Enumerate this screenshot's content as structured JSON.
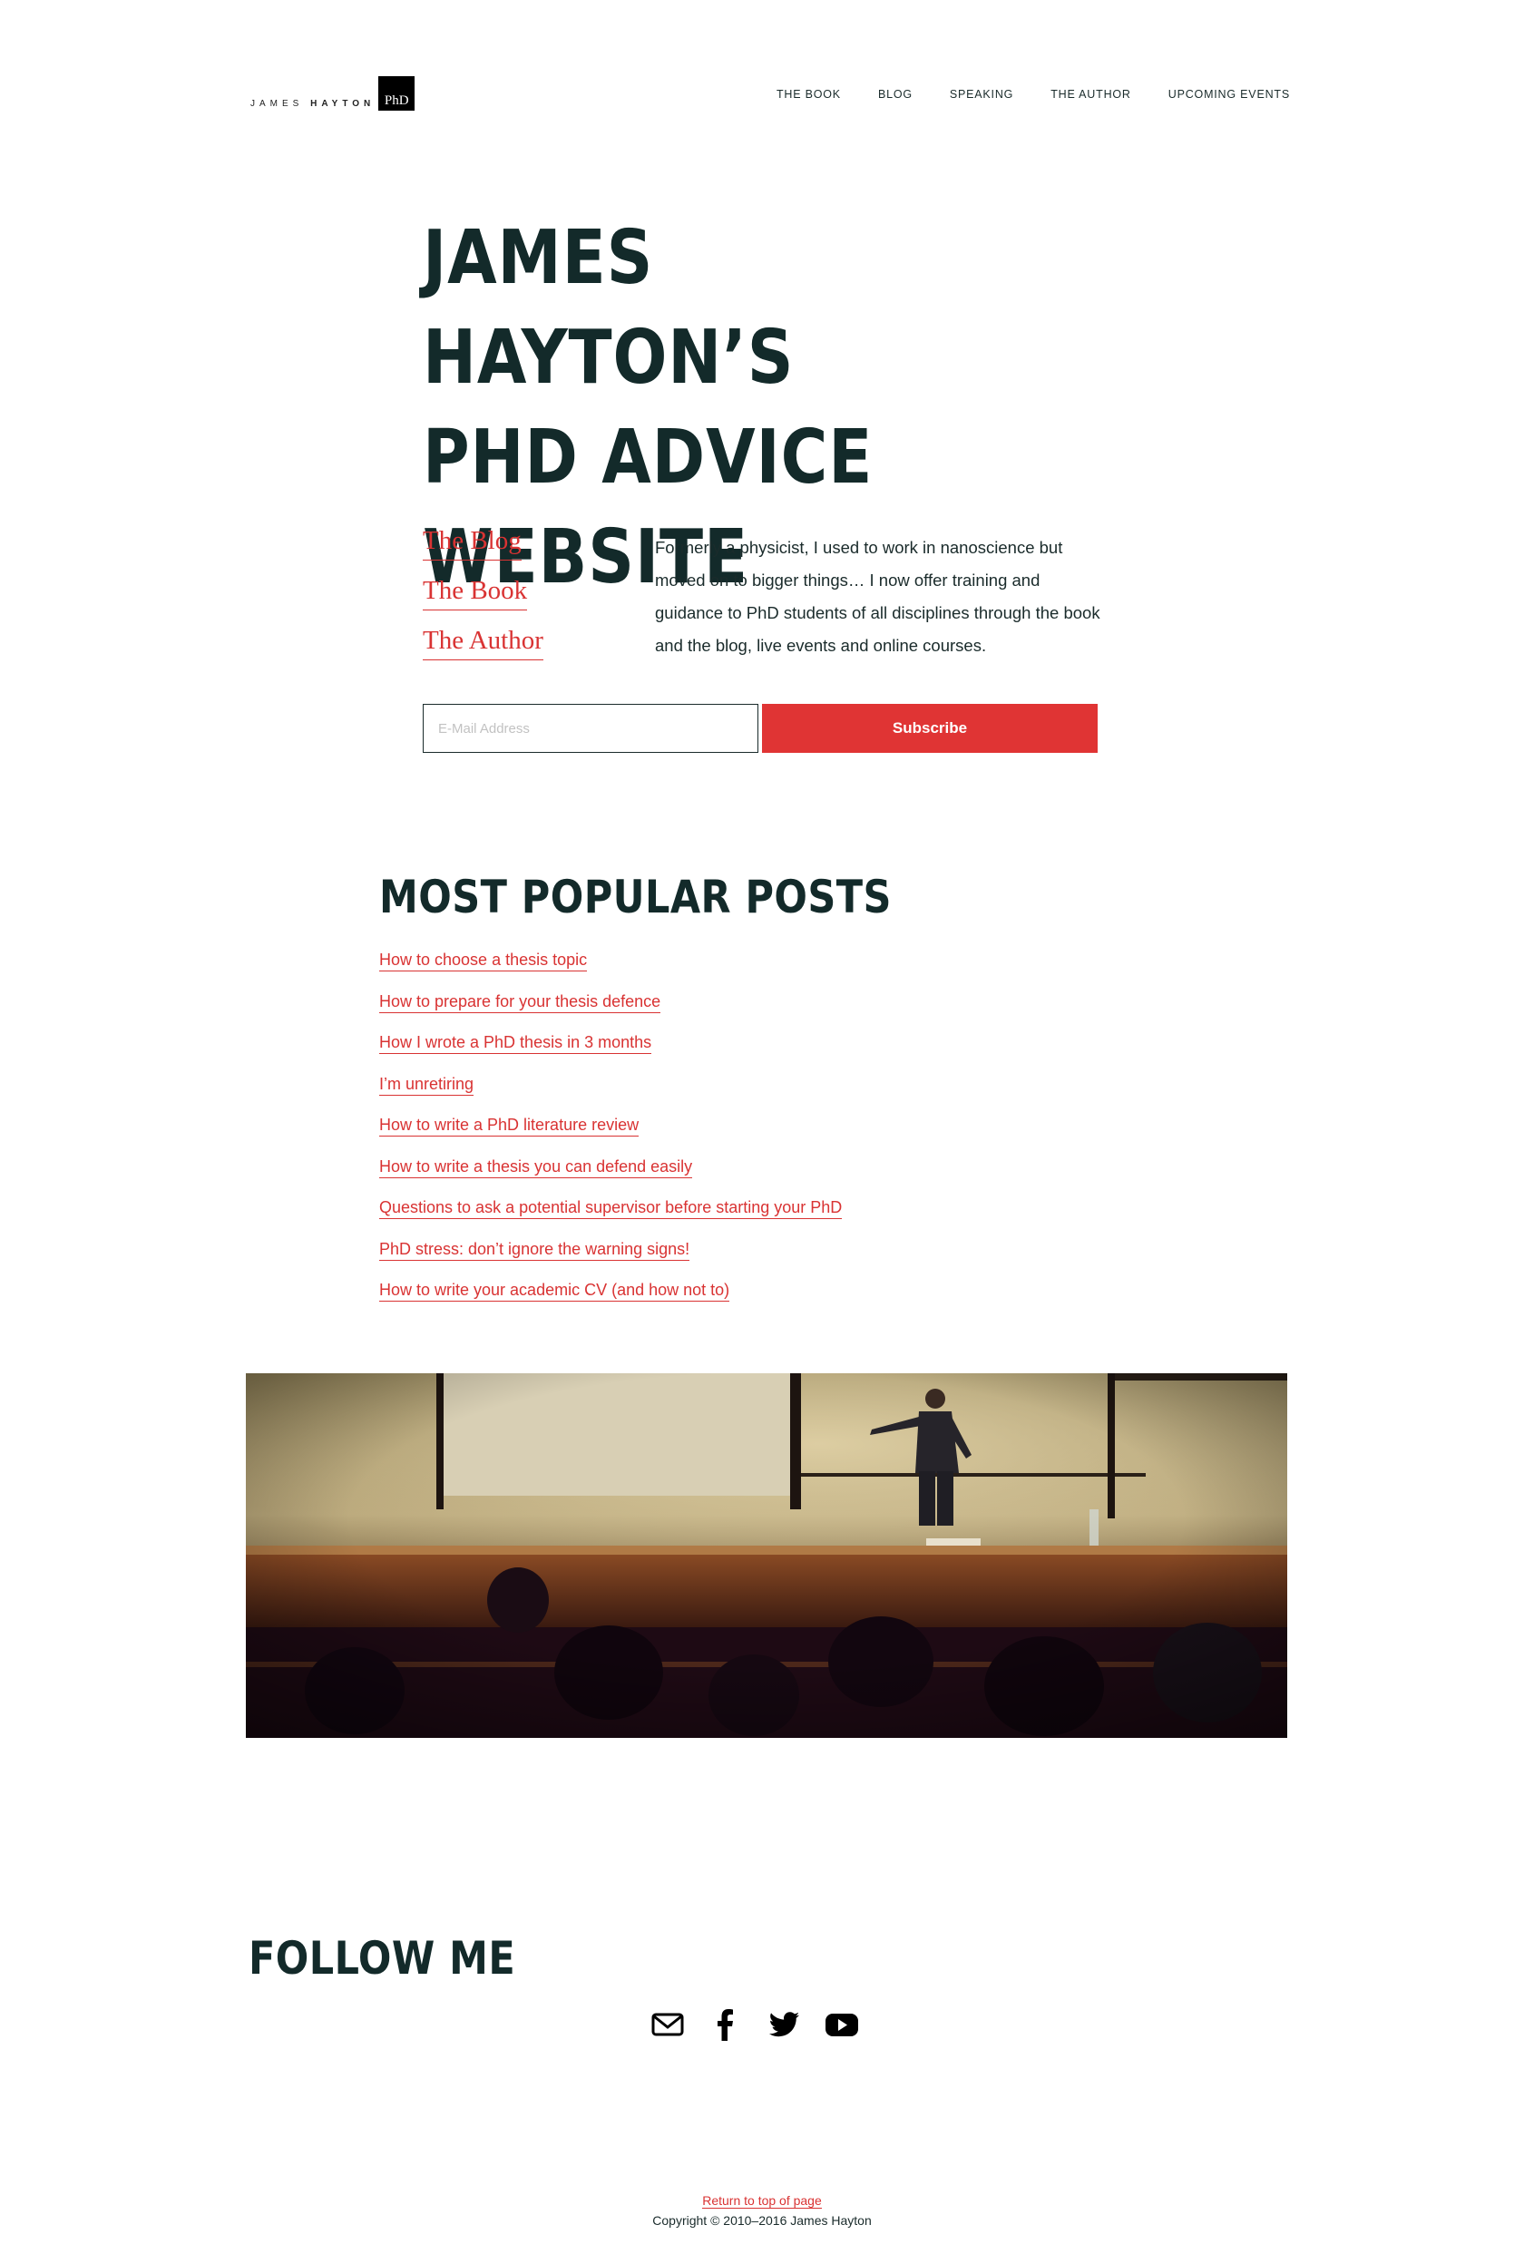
{
  "header": {
    "logo": {
      "first": "JAMES",
      "last": "HAYTON",
      "badge": "PhD"
    },
    "nav": [
      "The Book",
      "Blog",
      "Speaking",
      "The Author",
      "Upcoming Events"
    ]
  },
  "hero": {
    "title_lines": [
      "James Hayton’s",
      "PhD Advice",
      "Website"
    ],
    "links": [
      "The Blog",
      "The Book",
      "The Author"
    ],
    "intro": "Formerly a physicist, I used to work in nanoscience but moved on to bigger things… I now offer training and guidance to PhD students of all disciplines through the book and the blog, live events and online courses.",
    "email_placeholder": "E-Mail Address",
    "subscribe_label": "Subscribe"
  },
  "popular": {
    "title": "Most Popular Posts",
    "posts": [
      "How to choose a thesis topic",
      "How to prepare for your thesis defence",
      "How I wrote a PhD thesis in 3 months",
      "I’m unretiring",
      "How to write a PhD literature review",
      "How to write a thesis you can defend easily",
      "Questions to ask a potential supervisor before starting your PhD",
      "PhD stress: don’t ignore the warning signs!",
      "How to write your academic CV (and how not to)"
    ]
  },
  "follow": {
    "title": "Follow Me",
    "icons": [
      "email-icon",
      "facebook-icon",
      "twitter-icon",
      "youtube-icon"
    ]
  },
  "footer": {
    "return_link": "Return to top of page",
    "copyright": "Copyright © 2010–2016 James Hayton"
  },
  "colors": {
    "accent": "#e03434",
    "link": "#d93333",
    "heading": "#132a2a"
  }
}
